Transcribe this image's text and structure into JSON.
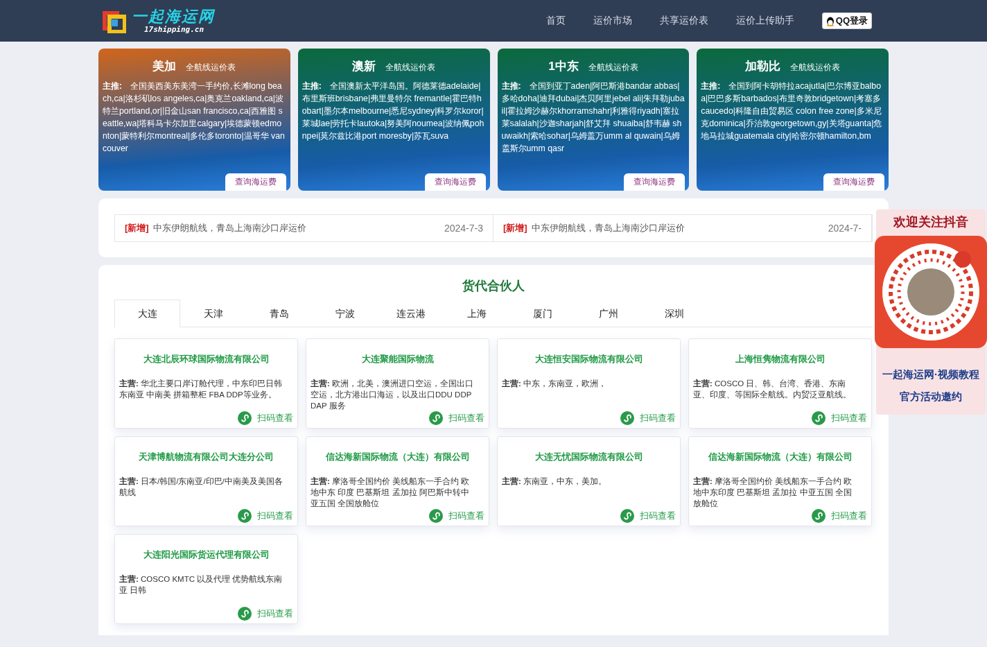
{
  "header": {
    "logo_title": "一起海运网",
    "logo_domain": "17shipping.cn",
    "nav": [
      "首页",
      "运价市场",
      "共享运价表",
      "运价上传助手"
    ],
    "login_button": "QQ登录"
  },
  "route_cards": [
    {
      "region": "美加",
      "subtitle": "全航线运价表",
      "color": "#d2651a",
      "text": "**主推:**　全国美西美东美湾一手约价,长滩long beach,ca|洛杉矶los angeles,ca|奥克兰oakland,ca|波特兰portland,or|旧金山san francisco,ca|西雅图 seattle,wa|塔科马卡尔加里calgary|埃德蒙顿edmonton|蒙特利尔montreal|多伦多toronto|温哥华 vancouver",
      "button": "查询海运费"
    },
    {
      "region": "澳新",
      "subtitle": "全航线运价表",
      "color": "#0b6a3c",
      "text": "**主推:**　全国澳新太平洋岛国。阿德莱德adelaide|布里斯班brisbane|弗里曼特尔 fremantle|霍巴特hobart|墨尔本melbourne|悉尼sydney|科罗尔koror|莱城lae|劳托卡lautoka|努美阿noumea|波纳佩pohnpei|莫尔兹比港port moresby|苏瓦suva",
      "button": "查询海运费"
    },
    {
      "region": "1中东",
      "subtitle": "全航线运价表",
      "color": "#0b6a3c",
      "text": "**主推:**　全国到亚丁aden|阿巴斯港bandar abbas|多哈doha|迪拜dubai|杰贝阿里jebel ali|朱拜勒jubail|霍拉姆沙赫尔khorramshahr|利雅得riyadh|塞拉莱salalah|沙迦sharjah|舒艾拜 shuaiba|舒韦赫 shuwaikh|索哈sohar|乌姆盖万umm al quwain|乌姆盖斯尔umm qasr",
      "button": "查询海运费"
    },
    {
      "region": "加勒比",
      "subtitle": "全航线运价表",
      "color": "#0b6a3c",
      "text": "**主推:**　全国到阿卡胡特拉acajutla|巴尔博亚balboa|巴巴多斯barbados|布里奇敦bridgetown|考塞多caucedo|科隆自由贸易区 colon free zone|多米尼克dominica|乔治敦georgetown,gy|关塔guanta|危地马拉城guatemala city|哈密尔顿hamilton,bm",
      "button": "查询海运费"
    }
  ],
  "news": [
    {
      "tag": "[新增]",
      "title": "中东伊朗航线，青岛上海南沙口岸运价",
      "date": "2024-7-3"
    },
    {
      "tag": "[新增]",
      "title": "中东伊朗航线，青岛上海南沙口岸运价",
      "date": "2024-7-"
    }
  ],
  "partners": {
    "title": "货代合伙人",
    "tabs": [
      {
        "label": "大连",
        "selected": true
      },
      {
        "label": "天津",
        "selected": false
      },
      {
        "label": "青岛",
        "selected": false
      },
      {
        "label": "宁波",
        "selected": false
      },
      {
        "label": "连云港",
        "selected": false
      },
      {
        "label": "上海",
        "selected": false
      },
      {
        "label": "厦门",
        "selected": false
      },
      {
        "label": "广州",
        "selected": false
      },
      {
        "label": "深圳",
        "selected": false
      }
    ],
    "companies": [
      {
        "name": "大连北辰环球国际物流有限公司",
        "business": "**主营:** 华北主要口岸订舱代理，中东印巴日韩东南亚 中南美 拼箱整柜 FBA DDP等业务。",
        "link": "扫码查看"
      },
      {
        "name": "大连聚能国际物流",
        "business": "**主营:** 欧洲，北美，澳洲进口空运，全国出口空运，北方港出口海运，以及出口DDU DDP DAP 服务",
        "link": "扫码查看"
      },
      {
        "name": "大连恒安国际物流有限公司",
        "business": "**主营:** 中东，东南亚，欧洲，",
        "link": "扫码查看"
      },
      {
        "name": "上海恒隽物流有限公司",
        "business": "**主营:** COSCO 日、韩、台湾、香港、东南亚、印度、等国际全航线。内贸泛亚航线。",
        "link": "扫码查看"
      },
      {
        "name": "天津博航物流有限公司大连分公司",
        "business": "**主营:** 日本/韩国/东南亚/印巴/中南美及美国各航线",
        "link": "扫码查看"
      },
      {
        "name": "信达海新国际物流（大连）有限公司",
        "business": "**主营:** 摩洛哥全国约价 美线船东一手合约 欧地中东 印度 巴基斯坦 孟加拉 阿巴斯中转中亚五国 全国放舱位",
        "link": "扫码查看"
      },
      {
        "name": "大连无忧国际物流有限公司",
        "business": "**主营:** 东南亚，中东，美加。",
        "link": "扫码查看"
      },
      {
        "name": "信达海新国际物流（大连）有限公司",
        "business": "**主营:** 摩洛哥全国约价 美线船东一手合约 欧地中东印度 巴基斯坦 孟加拉 中亚五国 全国放舱位",
        "link": "扫码查看"
      },
      {
        "name": "大连阳光国际货运代理有限公司",
        "business": "**主营:** COSCO KMTC 以及代理 优势航线东南亚 日韩",
        "link": "扫码查看"
      }
    ]
  },
  "promo": {
    "title": "欢迎关注抖音",
    "lines": [
      "一起海运网·视频教程",
      "官方活动邀约"
    ]
  }
}
